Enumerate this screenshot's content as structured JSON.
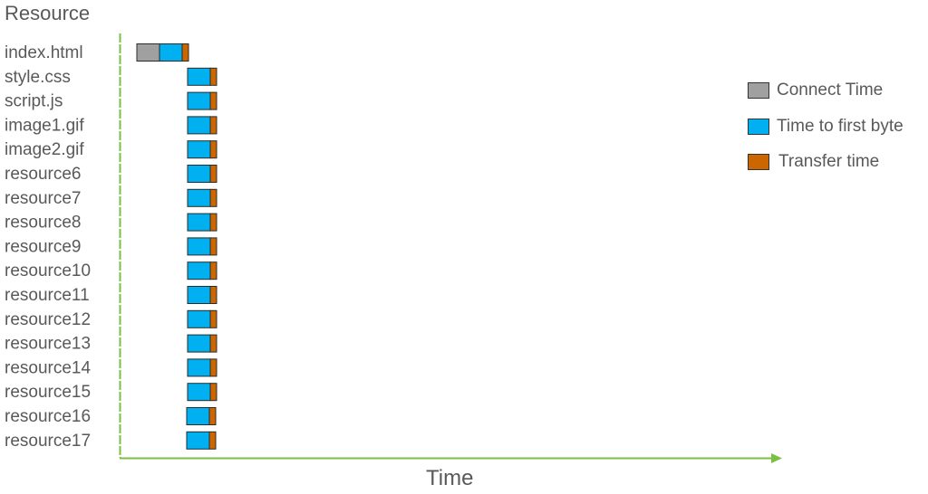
{
  "chart_data": {
    "type": "bar",
    "subtype": "stacked-horizontal-waterfall",
    "title": "Resource",
    "xlabel": "Time",
    "ylabel": "Resource",
    "xlim": [
      0,
      730
    ],
    "grid": false,
    "legend_position": "right",
    "categories": [
      "index.html",
      "style.css",
      "script.js",
      "image1.gif",
      "image2.gif",
      "resource6",
      "resource7",
      "resource8",
      "resource9",
      "resource10",
      "resource11",
      "resource12",
      "resource13",
      "resource14",
      "resource15",
      "resource16",
      "resource17"
    ],
    "start": [
      18,
      74,
      74,
      74,
      74,
      74,
      74,
      74,
      74,
      74,
      74,
      74,
      74,
      74,
      74,
      73,
      73
    ],
    "series": [
      {
        "name": "Connect Time",
        "color": "#a0a0a0",
        "values": [
          25,
          0,
          0,
          0,
          0,
          0,
          0,
          0,
          0,
          0,
          0,
          0,
          0,
          0,
          0,
          0,
          0
        ]
      },
      {
        "name": "Time to first byte",
        "color": "#00b0f0",
        "values": [
          25,
          25,
          25,
          25,
          25,
          25,
          25,
          25,
          25,
          25,
          25,
          25,
          25,
          25,
          25,
          25,
          25
        ]
      },
      {
        "name": "Transfer time",
        "color": "#cc6600",
        "values": [
          7,
          7,
          7,
          7,
          7,
          7,
          7,
          7,
          7,
          7,
          7,
          7,
          7,
          7,
          7,
          7,
          7
        ]
      }
    ],
    "axis_color": "#7ac143"
  },
  "legend": [
    {
      "label": "Connect Time",
      "color": "#a0a0a0"
    },
    {
      "label": "Time to first byte",
      "color": "#00b0f0"
    },
    {
      "label": "Transfer time",
      "color": "#cc6600"
    }
  ]
}
